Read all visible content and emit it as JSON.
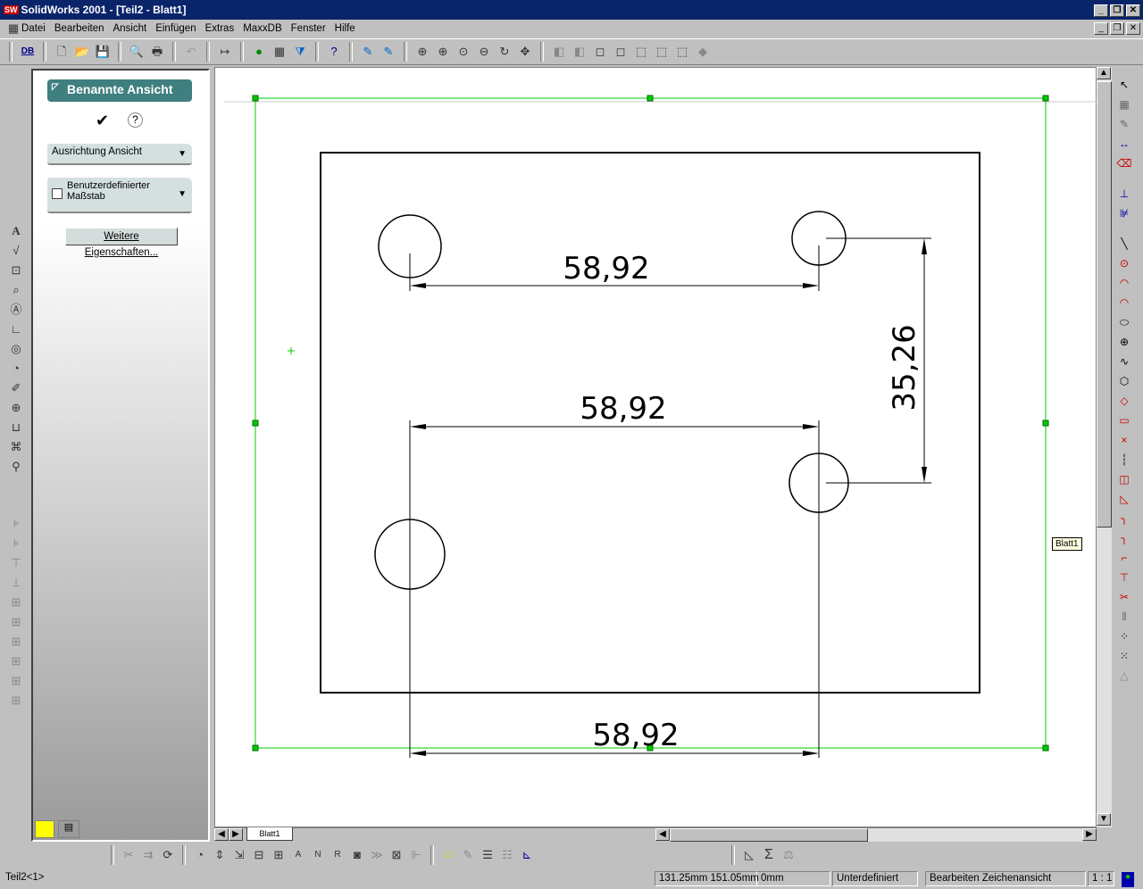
{
  "window": {
    "title": "SolidWorks 2001 - [Teil2 - Blatt1]",
    "logo": "SW"
  },
  "menu": [
    "Datei",
    "Bearbeiten",
    "Ansicht",
    "Einfügen",
    "Extras",
    "MaxxDB",
    "Fenster",
    "Hilfe"
  ],
  "toolbar": {
    "db_label": "DB"
  },
  "property_manager": {
    "title": "Benannte Ansicht",
    "orientation_label": "Ausrichtung Ansicht",
    "custom_scale_label": "Benutzerdefinierter Maßstab",
    "custom_scale_checked": false,
    "more_button": "Weitere Eigenschaften..."
  },
  "drawing": {
    "dimensions": [
      "58,92",
      "58,92",
      "35,26",
      "58,92"
    ],
    "sheet_tab": "Blatt1",
    "tooltip": "Blatt1"
  },
  "status": {
    "document": "Teil2<1>",
    "coordinates": "131.25mm 151.05mm",
    "z": "0mm",
    "state": "Unterdefiniert",
    "mode": "Bearbeiten Zeichenansicht",
    "scale": "1 : 1"
  }
}
